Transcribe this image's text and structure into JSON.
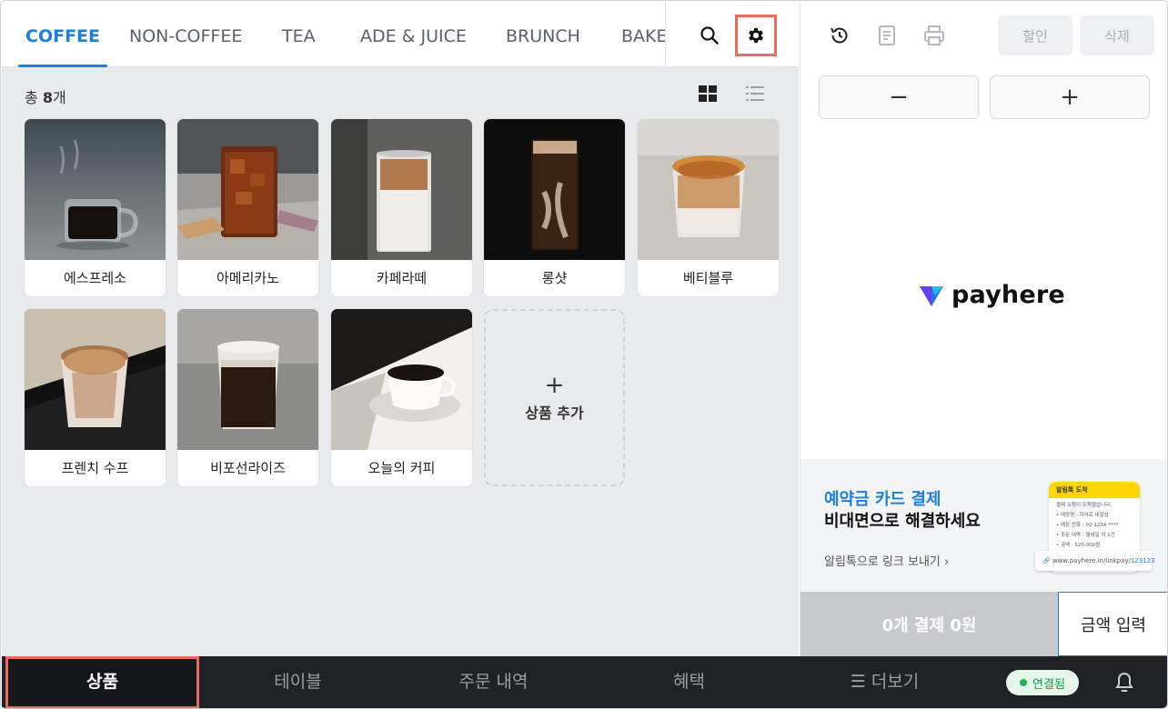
{
  "categories": [
    "COFFEE",
    "NON-COFFEE",
    "TEA",
    "ADE & JUICE",
    "BRUNCH",
    "BAKE"
  ],
  "count": {
    "prefix": "총",
    "value": "8",
    "suffix": "개"
  },
  "products": [
    {
      "name": "에스프레소",
      "image": "espresso-photo"
    },
    {
      "name": "아메리카노",
      "image": "americano-photo"
    },
    {
      "name": "카페라떼",
      "image": "cafe-latte-photo"
    },
    {
      "name": "롱샷",
      "image": "long-shot-photo"
    },
    {
      "name": "베티블루",
      "image": "betty-blue-photo"
    },
    {
      "name": "프렌치 수프",
      "image": "french-soup-photo"
    },
    {
      "name": "비포선라이즈",
      "image": "before-sunrise-photo"
    },
    {
      "name": "오늘의 커피",
      "image": "coffee-of-the-day-photo"
    }
  ],
  "add_product": {
    "plus": "+",
    "label": "상품 추가"
  },
  "right": {
    "discount_label": "할인",
    "delete_label": "삭제",
    "minus_label": "−",
    "plus_label": "+",
    "brand": "payhere",
    "promo": {
      "title_blue": "예약금 카드 결제",
      "title_black": "비대면으로 해결하세요",
      "link": "알림톡으로 링크 보내기 ›",
      "phone_header": "알림톡 도착",
      "phone_lines": [
        "결제 요청이 도착했습니다.",
        "• 매장명 : 히어로 네일샵",
        "• 매장 전화 : 02-1234-****",
        "• 주문 내역 : 젤네일 외 1건",
        "• 금액 : 520,000원"
      ],
      "url_prefix": "www.payhere.in/linkpay/",
      "url_code": "123123"
    },
    "pay_label": "0개 결제  0원",
    "amount_label": "금액 입력"
  },
  "bottom_nav": [
    "상품",
    "테이블",
    "주문 내역",
    "혜택",
    "☰ 더보기"
  ],
  "connection_label": "연결됨",
  "colors": {
    "accent": "#1a7fe0",
    "highlight": "#ec6c5c",
    "nav_bg": "#1f2226",
    "connected": "#21b35a"
  }
}
